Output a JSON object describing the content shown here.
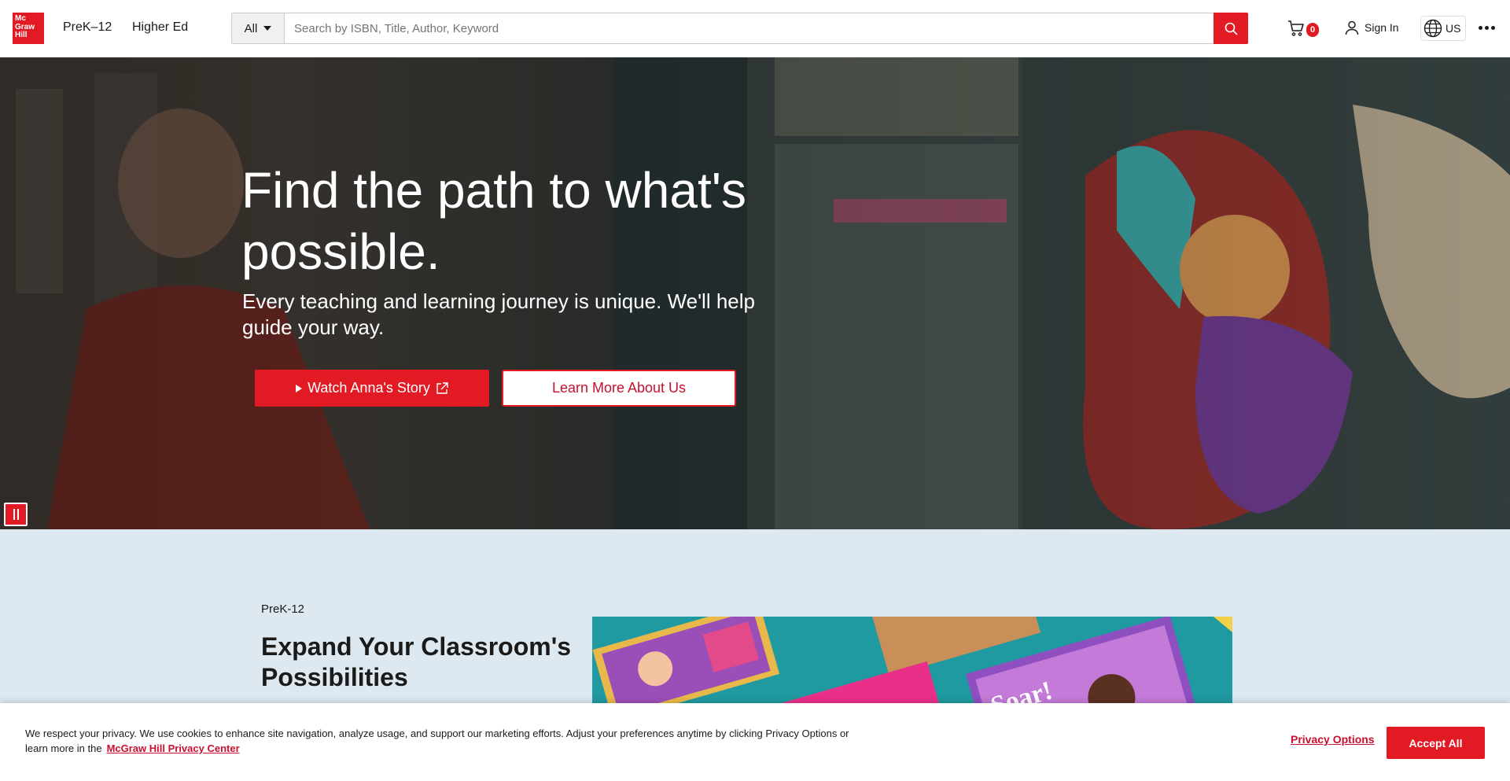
{
  "header": {
    "logo_text": "Mc Graw Hill",
    "nav": [
      "PreK–12",
      "Higher Ed"
    ],
    "search": {
      "category": "All",
      "placeholder": "Search by ISBN, Title, Author, Keyword"
    },
    "cart_count": "0",
    "signin_label": "Sign In",
    "region_label": "US"
  },
  "hero": {
    "title": "Find the path to what's possible.",
    "subtitle": "Every teaching and learning journey is unique. We'll help guide your way.",
    "primary_button": "Watch Anna's Story",
    "secondary_button": "Learn More About Us"
  },
  "section": {
    "eyebrow": "PreK-12",
    "title": "Expand Your Classroom's Possibilities"
  },
  "cookie": {
    "text": "We respect your privacy. We use cookies to enhance site navigation, analyze usage, and support our marketing efforts. Adjust your preferences anytime by clicking Privacy Options or learn more in the",
    "link_text": "McGraw Hill Privacy Center",
    "privacy_options": "Privacy Options",
    "accept_all": "Accept All"
  },
  "colors": {
    "brand_red": "#e21a23",
    "section_bg": "#dde8f1"
  }
}
